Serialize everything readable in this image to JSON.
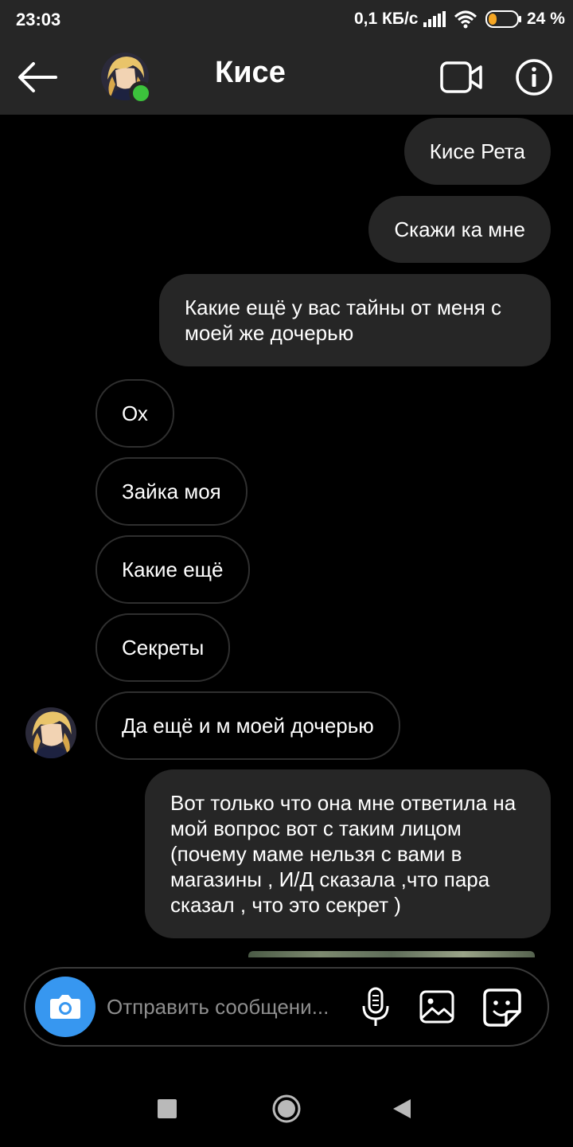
{
  "status_bar": {
    "time": "23:03",
    "speed": "0,1 КБ/с",
    "battery_pct": "24 %",
    "icons": [
      "signal-icon",
      "wifi-icon",
      "battery-icon"
    ]
  },
  "header": {
    "contact_name": "Кисе",
    "online": true,
    "icons": [
      "back-arrow-icon",
      "video-camera-icon",
      "info-icon"
    ]
  },
  "messages": [
    {
      "direction": "out",
      "text": "Кисе Рета"
    },
    {
      "direction": "out",
      "text": "Скажи ка мне"
    },
    {
      "direction": "out",
      "text": "Какие ещё у вас тайны от меня с моей же дочерью"
    },
    {
      "direction": "in",
      "text": "Ох"
    },
    {
      "direction": "in",
      "text": "Зайка моя"
    },
    {
      "direction": "in",
      "text": "Какие ещё"
    },
    {
      "direction": "in",
      "text": "Секреты"
    },
    {
      "direction": "in",
      "text": "Да ещё и м моей дочерью"
    },
    {
      "direction": "out",
      "text": "Вот только что она мне ответила на мой вопрос вот с таким лицом (почему маме нельзя с вами в магазины , И/Д сказала ,что пара сказал , что это секрет )"
    }
  ],
  "composer": {
    "placeholder": "Отправить сообщени...",
    "value": "",
    "icons": [
      "camera-icon",
      "microphone-icon",
      "gallery-icon",
      "sticker-icon"
    ]
  },
  "colors": {
    "bar_background": "#262626",
    "outgoing_bubble": "#262626",
    "incoming_border": "#2f2f2f",
    "accent_blue": "#3797f0",
    "online_green": "#3cc23c"
  },
  "nav_bar": {
    "icons": [
      "recent-apps-icon",
      "home-icon",
      "back-icon"
    ]
  }
}
